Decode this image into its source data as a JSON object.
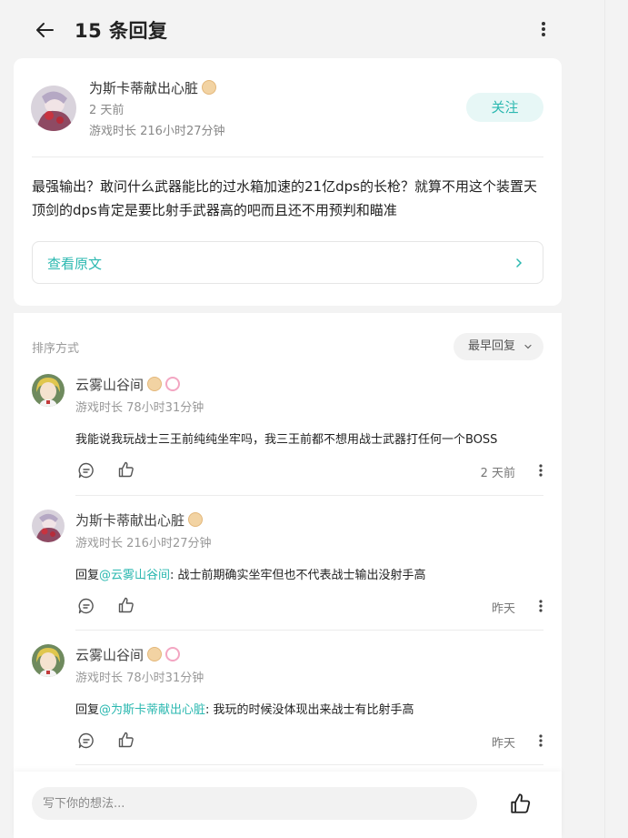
{
  "header": {
    "title": "15 条回复"
  },
  "post": {
    "author": "为斯卡蒂献出心脏",
    "date": "2 天前",
    "playtime": "游戏时长 216小时27分钟",
    "follow_label": "关注",
    "body": "最强输出？敢问什么武器能比的过水箱加速的21亿dps的长枪？就算不用这个装置天顶剑的dps肯定是要比射手武器高的吧而且还不用预判和瞄准",
    "view_original_label": "查看原文"
  },
  "sort": {
    "label": "排序方式",
    "selected": "最早回复"
  },
  "replies": [
    {
      "name": "云雾山谷间",
      "playtime": "游戏时长 78小时31分钟",
      "prefix": "",
      "mention": "",
      "text": "我能说我玩战士三王前纯纯坐牢吗，我三王前都不想用战士武器打任何一个BOSS",
      "time": "2 天前"
    },
    {
      "name": "为斯卡蒂献出心脏",
      "playtime": "游戏时长 216小时27分钟",
      "prefix": "回复",
      "mention": "@云雾山谷间",
      "text": ": 战士前期确实坐牢但也不代表战士输出没射手高",
      "time": "昨天"
    },
    {
      "name": "云雾山谷间",
      "playtime": "游戏时长 78小时31分钟",
      "prefix": "回复",
      "mention": "@为斯卡蒂献出心脏",
      "text": ": 我玩的时候没体现出来战士有比射手高",
      "time": "昨天"
    }
  ],
  "composer": {
    "placeholder": "写下你的想法..."
  },
  "colors": {
    "accent": "#2bb8b0",
    "follow_bg": "#e7f7f6",
    "background": "#f3f3f3"
  },
  "icons": {
    "back": "arrow-left-icon",
    "more": "more-vertical-icon",
    "comment": "comment-bubble-icon",
    "like": "thumbs-up-icon",
    "chevron": "chevron-right-icon",
    "badge": "level-badge-icon"
  }
}
